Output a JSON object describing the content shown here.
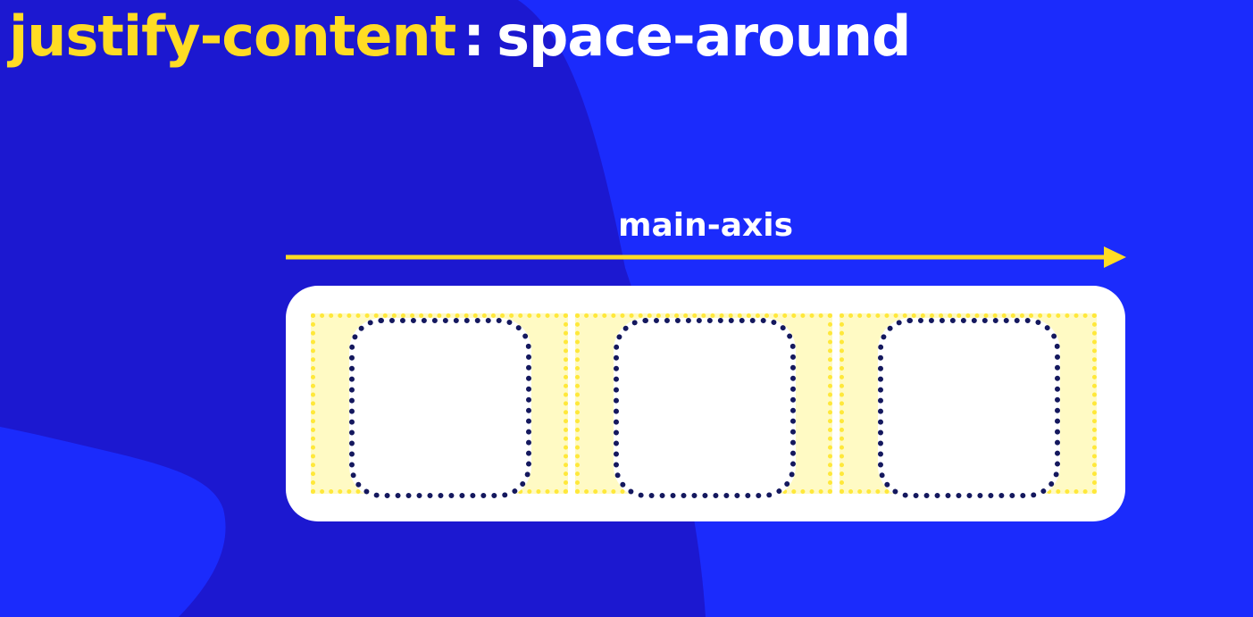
{
  "title": {
    "property": "justify-content",
    "separator": ":",
    "value": "space-around"
  },
  "axis": {
    "label": "main-axis",
    "color": "#ffdc24"
  },
  "colors": {
    "background": "#1b2bfc",
    "background_shape": "#1c18d0",
    "container": "#ffffff",
    "space_fill": "#fffac4",
    "space_border": "#ffe83a",
    "item_border": "#14185e"
  },
  "flex_items": [
    {
      "label": ""
    },
    {
      "label": ""
    },
    {
      "label": ""
    }
  ]
}
